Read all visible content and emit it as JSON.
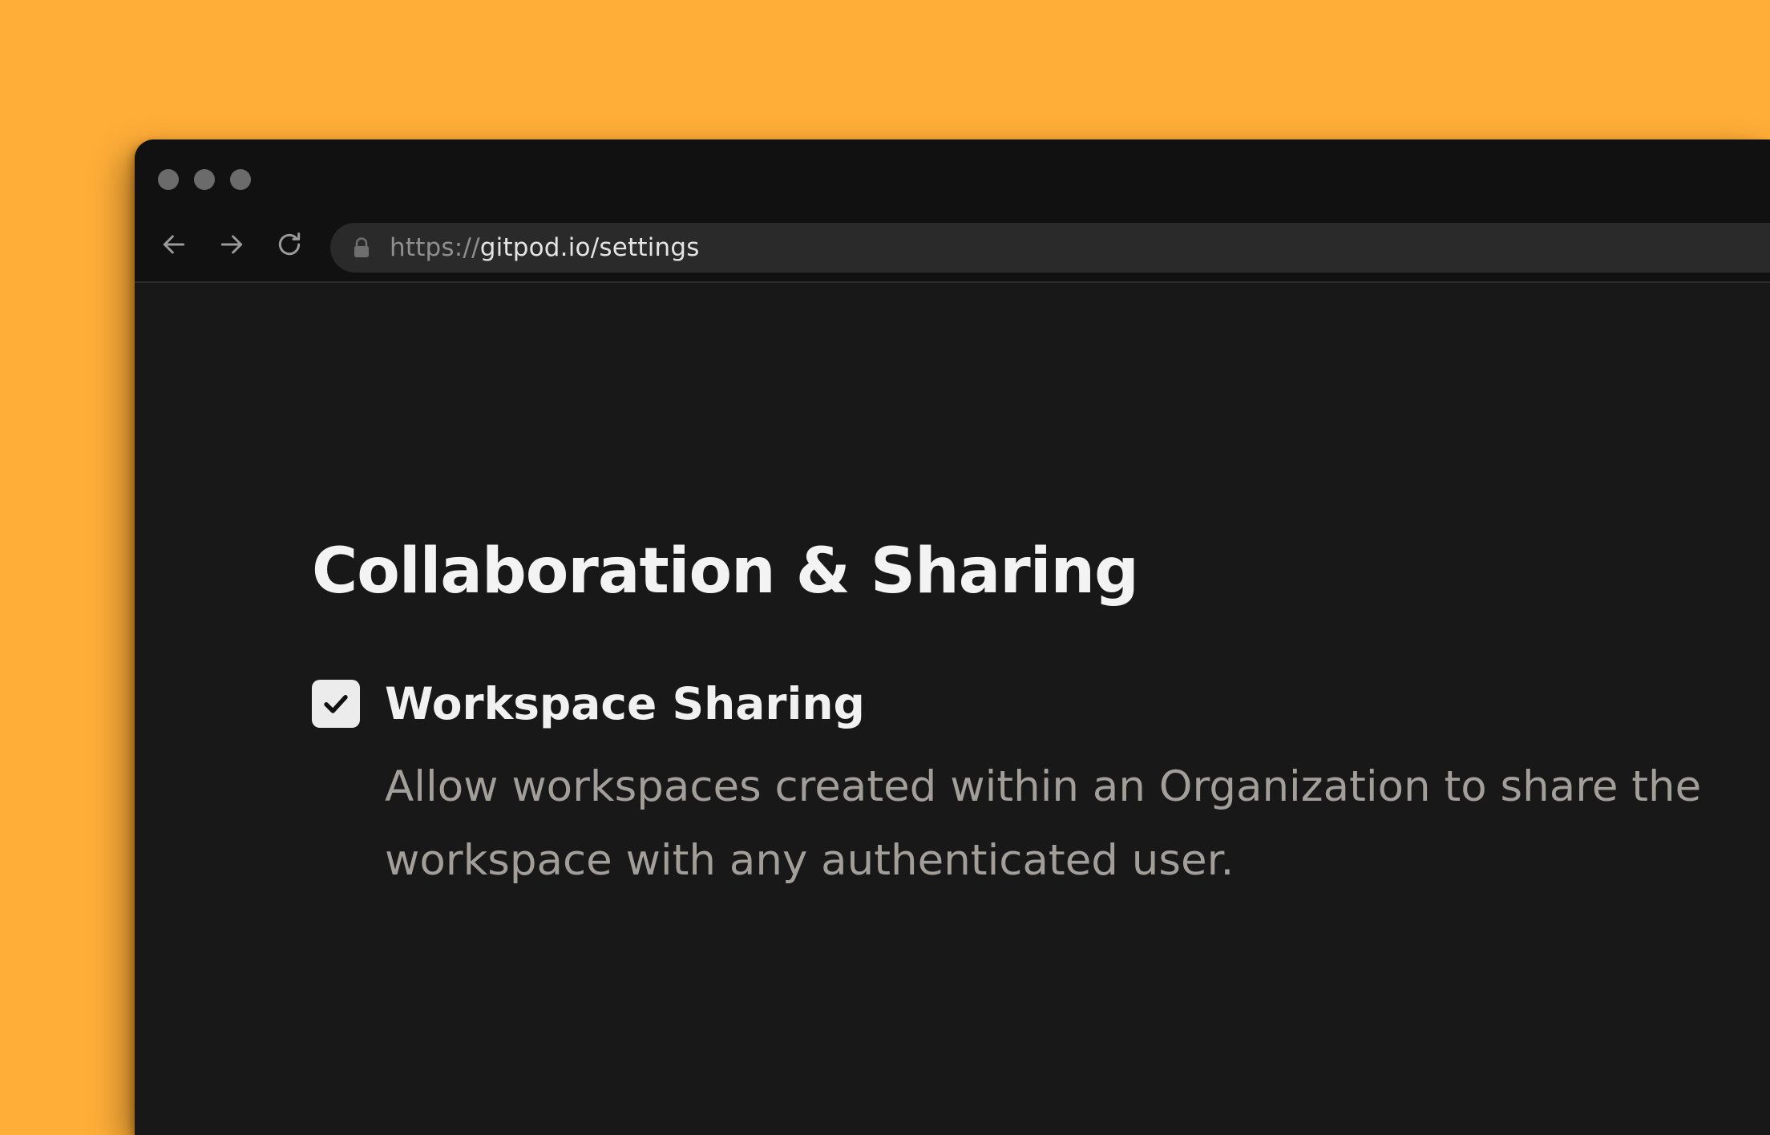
{
  "browser": {
    "url_scheme": "https://",
    "url_host_path": "gitpod.io/settings"
  },
  "page": {
    "title": "Collaboration & Sharing",
    "settings": [
      {
        "label": "Workspace Sharing",
        "checked": true,
        "description": "Allow workspaces created within an Organization to share the workspace with any authenticated user."
      }
    ]
  },
  "colors": {
    "background": "#FFAE38",
    "window": "#181818",
    "title_bar": "#111111",
    "address_bar": "#2a2a2b",
    "checkbox": "#ececec"
  },
  "icons": {
    "back": "arrow-left-icon",
    "forward": "arrow-right-icon",
    "reload": "reload-icon",
    "lock": "lock-icon",
    "check": "checkmark-icon"
  }
}
